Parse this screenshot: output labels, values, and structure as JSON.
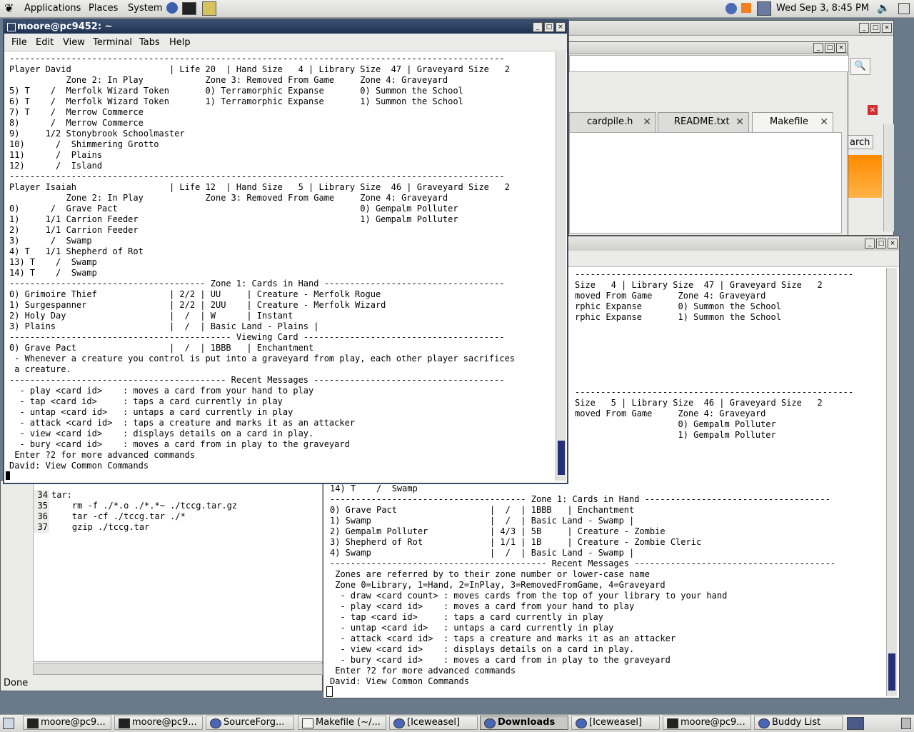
{
  "top_panel": {
    "menus": [
      "Applications",
      "Places",
      "System"
    ],
    "clock": "Wed Sep  3,  8:45 PM"
  },
  "terminal_front": {
    "title": "moore@pc9452: ~",
    "menu": [
      "File",
      "Edit",
      "View",
      "Terminal",
      "Tabs",
      "Help"
    ],
    "lines": [
      "------------------------------------------------------------------------------------------------",
      "Player David                   | Life 20  | Hand Size   4 | Library Size  47 | Graveyard Size   2",
      "           Zone 2: In Play            Zone 3: Removed From Game     Zone 4: Graveyard",
      "5) T    /  Merfolk Wizard Token       0) Terramorphic Expanse       0) Summon the School",
      "6) T    /  Merfolk Wizard Token       1) Terramorphic Expanse       1) Summon the School",
      "7) T    /  Merrow Commerce",
      "8)      /  Merrow Commerce",
      "9)     1/2 Stonybrook Schoolmaster",
      "10)      /  Shimmering Grotto",
      "11)      /  Plains",
      "12)      /  Island",
      "------------------------------------------------------------------------------------------------",
      "Player Isaiah                  | Life 12  | Hand Size   5 | Library Size  46 | Graveyard Size   2",
      "           Zone 2: In Play            Zone 3: Removed From Game     Zone 4: Graveyard",
      "0)      /  Grave Pact                                               0) Gempalm Polluter",
      "1)     1/1 Carrion Feeder                                           1) Gempalm Polluter",
      "2)     1/1 Carrion Feeder",
      "3)      /  Swamp",
      "4) T   1/1 Shepherd of Rot",
      "13) T    /  Swamp",
      "14) T    /  Swamp",
      "-------------------------------------- Zone 1: Cards in Hand -----------------------------------",
      "0) Grimoire Thief              | 2/2 | UU     | Creature - Merfolk Rogue",
      "1) Surgespanner                | 2/2 | 2UU    | Creature - Merfolk Wizard",
      "2) Holy Day                    |  /  | W      | Instant",
      "3) Plains                      |  /  | Basic Land - Plains |",
      "------------------------------------------- Viewing Card ---------------------------------------",
      "0) Grave Pact                  |  /  | 1BBB   | Enchantment",
      " - Whenever a creature you control is put into a graveyard from play, each other player sacrifices",
      " a creature.",
      "------------------------------------------ Recent Messages -------------------------------------",
      "  - play <card id>    : moves a card from your hand to play",
      "  - tap <card id>     : taps a card currently in play",
      "  - untap <card id>   : untaps a card currently in play",
      "  - attack <card id>  : taps a creature and marks it as an attacker",
      "  - view <card id>    : displays details on a card in play.",
      "  - bury <card id>    : moves a card from in play to the graveyard",
      " Enter ?2 for more advanced commands",
      "David: View Common Commands"
    ]
  },
  "terminal_back": {
    "lines_top": [
      "------------------------------------------------------",
      "Size   4 | Library Size  47 | Graveyard Size   2",
      "moved From Game     Zone 4: Graveyard",
      "rphic Expanse       0) Summon the School",
      "rphic Expanse       1) Summon the School"
    ],
    "lines_mid": [
      "------------------------------------------------------",
      "Size   5 | Library Size  46 | Graveyard Size   2",
      "moved From Game     Zone 4: Graveyard",
      "                    0) Gempalm Polluter",
      "                    1) Gempalm Polluter"
    ],
    "lines_bottom": [
      "14) T    /  Swamp",
      "-------------------------------------- Zone 1: Cards in Hand ------------------------------------",
      "0) Grave Pact                  |  /  | 1BBB   | Enchantment",
      "1) Swamp                       |  /  | Basic Land - Swamp |",
      "2) Gempalm Polluter            | 4/3 | 5B     | Creature - Zombie",
      "3) Shepherd of Rot             | 1/1 | 1B     | Creature - Zombie Cleric",
      "4) Swamp                       |  /  | Basic Land - Swamp |",
      "------------------------------------------ Recent Messages ---------------------------------------",
      " Zones are referred by to their zone number or lower-case name",
      " Zone 0=Library, 1=Hand, 2=InPlay, 3=RemovedFromGame, 4=Graveyard",
      "  - draw <card count> : moves cards from the top of your library to your hand",
      "  - play <card id>    : moves a card from your hand to play",
      "  - tap <card id>     : taps a card currently in play",
      "  - untap <card id>   : untaps a card currently in play",
      "  - attack <card id>  : taps a creature and marks it as an attacker",
      "  - view <card id>    : displays details on a card in play.",
      "  - bury <card id>    : moves a card from in play to the graveyard",
      " Enter ?2 for more advanced commands",
      "David: View Common Commands"
    ]
  },
  "editor": {
    "tabs": [
      "cardpile.h",
      "README.txt",
      "Makefile"
    ],
    "line_numbers": [
      "34",
      "35",
      "36",
      "37"
    ],
    "code": [
      "tar:",
      "    rm -f ./*.o ./*.*~ ./tccg.tar.gz",
      "    tar -cf ./tccg.tar ./*",
      "    gzip ./tccg.tar"
    ]
  },
  "browser": {
    "search_label": "arch",
    "status": "Done"
  },
  "taskbar": [
    {
      "label": "moore@pc9...",
      "icon": "terminal-icon"
    },
    {
      "label": "moore@pc9...",
      "icon": "terminal-icon"
    },
    {
      "label": "SourceForg...",
      "icon": "browser-icon"
    },
    {
      "label": "Makefile (~/...",
      "icon": "editor-icon"
    },
    {
      "label": "[Iceweasel]",
      "icon": "browser-icon"
    },
    {
      "label": "Downloads",
      "icon": "browser-icon"
    },
    {
      "label": "[Iceweasel]",
      "icon": "browser-icon"
    },
    {
      "label": "moore@pc9...",
      "icon": "terminal-icon"
    },
    {
      "label": "Buddy List",
      "icon": "chat-icon"
    }
  ]
}
